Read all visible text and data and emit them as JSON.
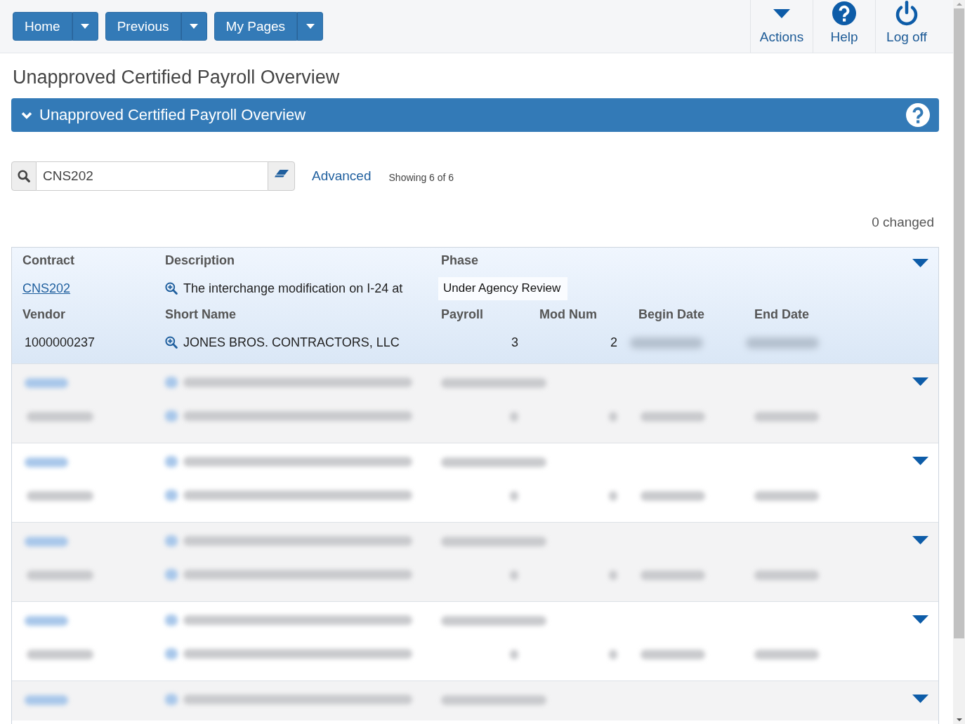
{
  "nav": {
    "buttons": [
      {
        "label": "Home"
      },
      {
        "label": "Previous"
      },
      {
        "label": "My Pages"
      }
    ],
    "actions": [
      {
        "kind": "menu",
        "label": "Actions"
      },
      {
        "kind": "help",
        "label": "Help"
      },
      {
        "kind": "logoff",
        "label": "Log off"
      }
    ]
  },
  "page_title": "Unapproved Certified Payroll Overview",
  "panel": {
    "title": "Unapproved Certified Payroll Overview",
    "expanded": true
  },
  "search": {
    "value": "CNS202",
    "advanced_link": "Advanced",
    "result_count": "Showing 6 of 6"
  },
  "changes": "0 changed",
  "table": {
    "labels": [
      "Contract",
      "Description",
      "Phase",
      "Vendor",
      "Short Name",
      "Payroll",
      "Mod Num",
      "Begin Date",
      "End Date"
    ],
    "rows": [
      {
        "selected": true,
        "redacted": false,
        "cut_off": false,
        "contract": "CNS202",
        "description": "The interchange modification on I-24 at",
        "phase": "Under Agency Review",
        "vendor": "1000000237",
        "short_name": "JONES BROS. CONTRACTORS, LLC",
        "payroll": "3",
        "mod_num": "2",
        "dates_redacted": true
      },
      {
        "selected": false,
        "redacted": true,
        "cut_off": false
      },
      {
        "selected": false,
        "redacted": true,
        "cut_off": false
      },
      {
        "selected": false,
        "redacted": true,
        "cut_off": false
      },
      {
        "selected": false,
        "redacted": true,
        "cut_off": false
      },
      {
        "selected": false,
        "redacted": true,
        "cut_off": true
      }
    ]
  }
}
